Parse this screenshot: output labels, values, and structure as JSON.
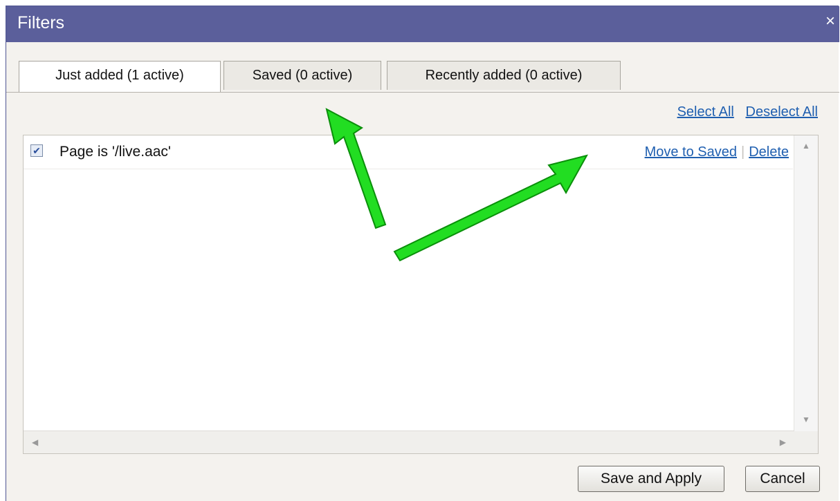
{
  "dialog": {
    "title": "Filters",
    "close_glyph": "×"
  },
  "tabs": [
    {
      "label": "Just added (1 active)",
      "active": true
    },
    {
      "label": "Saved (0 active)",
      "active": false
    },
    {
      "label": "Recently added (0 active)",
      "active": false
    }
  ],
  "selection": {
    "select_all": "Select All",
    "deselect_all": "Deselect All"
  },
  "filters": [
    {
      "label": "Page is '/live.aac'",
      "checked": true,
      "check_glyph": "✔",
      "move_label": "Move to Saved",
      "delete_label": "Delete"
    }
  ],
  "scroll": {
    "up": "▲",
    "down": "▼",
    "left": "◀",
    "right": "▶"
  },
  "footer": {
    "save_apply": "Save and Apply",
    "cancel": "Cancel"
  },
  "annotations": {
    "arrow_color": "#22dd22",
    "arrow_outline": "#0a8f0a"
  }
}
